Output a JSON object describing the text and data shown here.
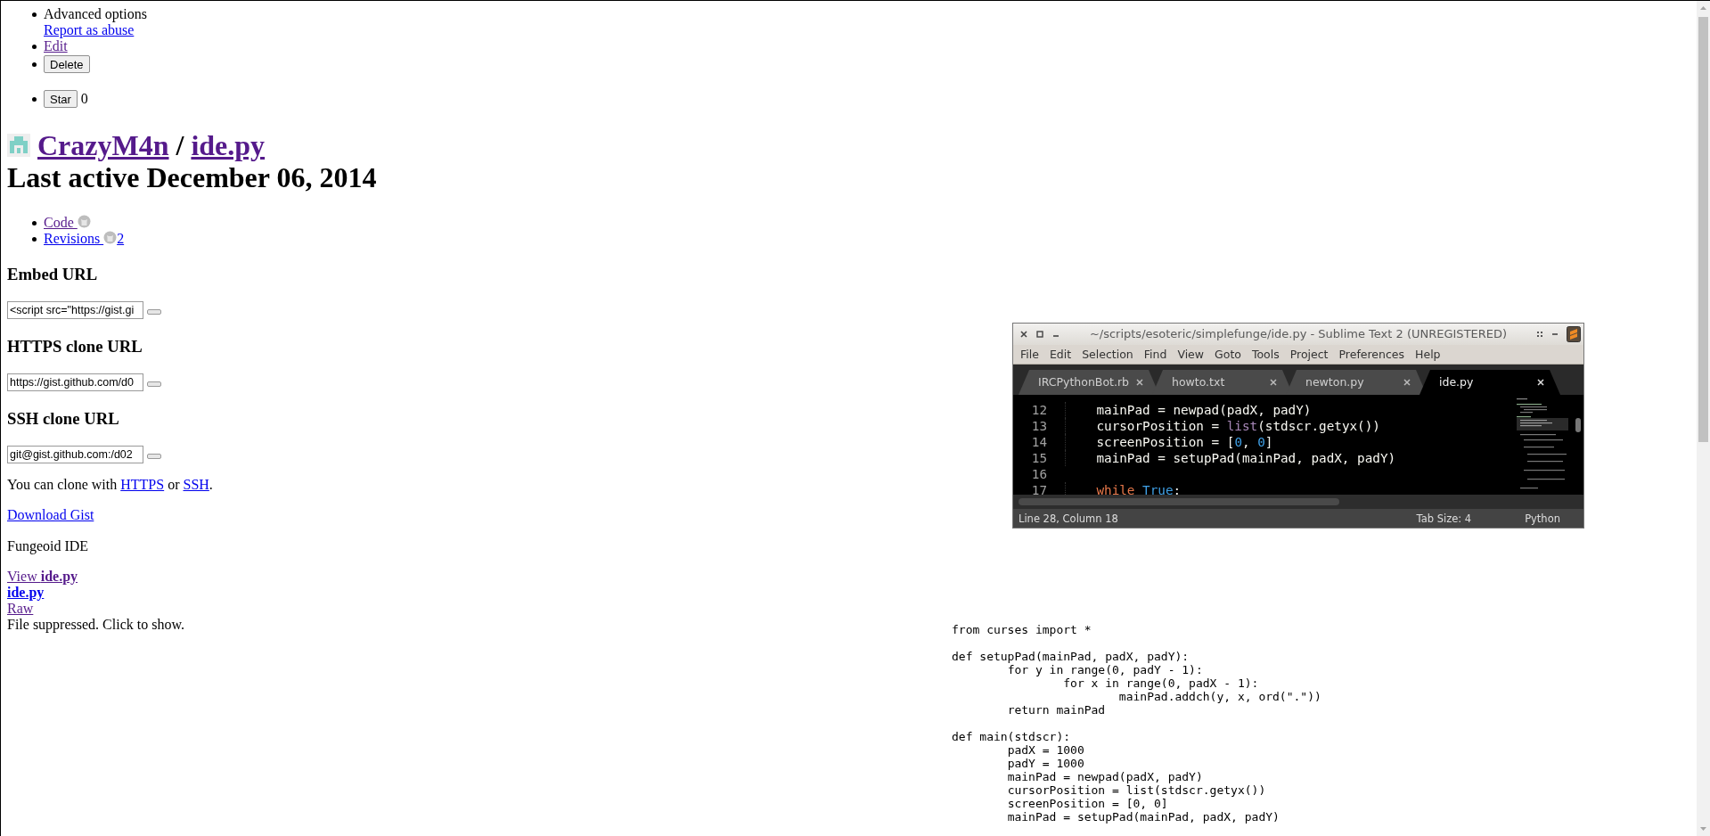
{
  "actions": {
    "advanced_label": "Advanced options",
    "links": [
      {
        "label": "Report as abuse",
        "visited": false
      },
      {
        "label": "Edit",
        "visited": true
      }
    ],
    "delete_button": "Delete"
  },
  "star": {
    "button": "Star",
    "count": "0"
  },
  "title": {
    "owner": {
      "label": "CrazyM4n",
      "visited": true
    },
    "separator": "/",
    "file": {
      "label": "ide.py",
      "visited": true
    }
  },
  "last_active": "Last active December 06, 2014",
  "nav": [
    {
      "label": "Code",
      "visited": true
    },
    {
      "label": "Revisions",
      "visited": false,
      "count": "2"
    }
  ],
  "clone_fields": [
    {
      "heading": "Embed URL",
      "value": "<script src=\"https://gist.gi"
    },
    {
      "heading": "HTTPS clone URL",
      "value": "https://gist.github.com/d0"
    },
    {
      "heading": "SSH clone URL",
      "value": "git@gist.github.com:/d02"
    }
  ],
  "clone_note": [
    {
      "kind": "text",
      "text": "You can clone with "
    },
    {
      "kind": "link",
      "text": "HTTPS",
      "visited": false
    },
    {
      "kind": "text",
      "text": " or "
    },
    {
      "kind": "link",
      "text": "SSH",
      "visited": false
    },
    {
      "kind": "text",
      "text": "."
    }
  ],
  "download_link": {
    "label": "Download Gist",
    "visited": false
  },
  "description": "Fungeoid IDE",
  "file": {
    "view_link": {
      "label": "View **ide.py**",
      "visited": true
    },
    "name_link": {
      "label": "ide.py",
      "visited": false
    },
    "raw_link": {
      "label": "Raw",
      "visited": true
    },
    "notice": "File suppressed. Click to show."
  },
  "screenshot": {
    "title": "~/scripts/esoteric/simplefunge/ide.py - Sublime Text 2 (UNREGISTERED)",
    "menu": [
      "File",
      "Edit",
      "Selection",
      "Find",
      "View",
      "Goto",
      "Tools",
      "Project",
      "Preferences",
      "Help"
    ],
    "tabs": [
      {
        "label": "IRCPythonBot.rb",
        "selected": false
      },
      {
        "label": "howto.txt",
        "selected": false
      },
      {
        "label": "newton.py",
        "selected": false
      },
      {
        "label": "ide.py",
        "selected": true
      }
    ],
    "lines": [
      {
        "number": "12",
        "tokens": [
          {
            "kind": "plain",
            "text": "    mainPad = newpad(padX, padY)"
          }
        ]
      },
      {
        "number": "13",
        "tokens": [
          {
            "kind": "plain",
            "text": "    cursorPosition = "
          },
          {
            "kind": "builtin",
            "text": "list"
          },
          {
            "kind": "plain",
            "text": "(stdscr.getyx())"
          }
        ]
      },
      {
        "number": "14",
        "tokens": [
          {
            "kind": "plain",
            "text": "    screenPosition = ["
          },
          {
            "kind": "constant",
            "text": "0"
          },
          {
            "kind": "plain",
            "text": ", "
          },
          {
            "kind": "constant",
            "text": "0"
          },
          {
            "kind": "plain",
            "text": "]"
          }
        ]
      },
      {
        "number": "15",
        "tokens": [
          {
            "kind": "plain",
            "text": "    mainPad = setupPad(mainPad, padX, padY)"
          }
        ]
      },
      {
        "number": "16"
      },
      {
        "number": "17",
        "tokens": [
          {
            "kind": "keyword",
            "text": "    while "
          },
          {
            "kind": "constant",
            "text": "True"
          },
          {
            "kind": "plain",
            "text": ":"
          }
        ]
      }
    ],
    "status": {
      "position": "Line 28, Column 18",
      "tab_size": "Tab Size: 4",
      "syntax": "Python"
    }
  },
  "code": "from curses import *\n\ndef setupPad(mainPad, padX, padY):\n\tfor y in range(0, padY - 1):\n\t\tfor x in range(0, padX - 1):\n\t\t\tmainPad.addch(y, x, ord(\".\"))\n\treturn mainPad\n\ndef main(stdscr):\n\tpadX = 1000\n\tpadY = 1000\n\tmainPad = newpad(padX, padY)\n\tcursorPosition = list(stdscr.getyx())\n\tscreenPosition = [0, 0]\n\tmainPad = setupPad(mainPad, padX, padY)"
}
